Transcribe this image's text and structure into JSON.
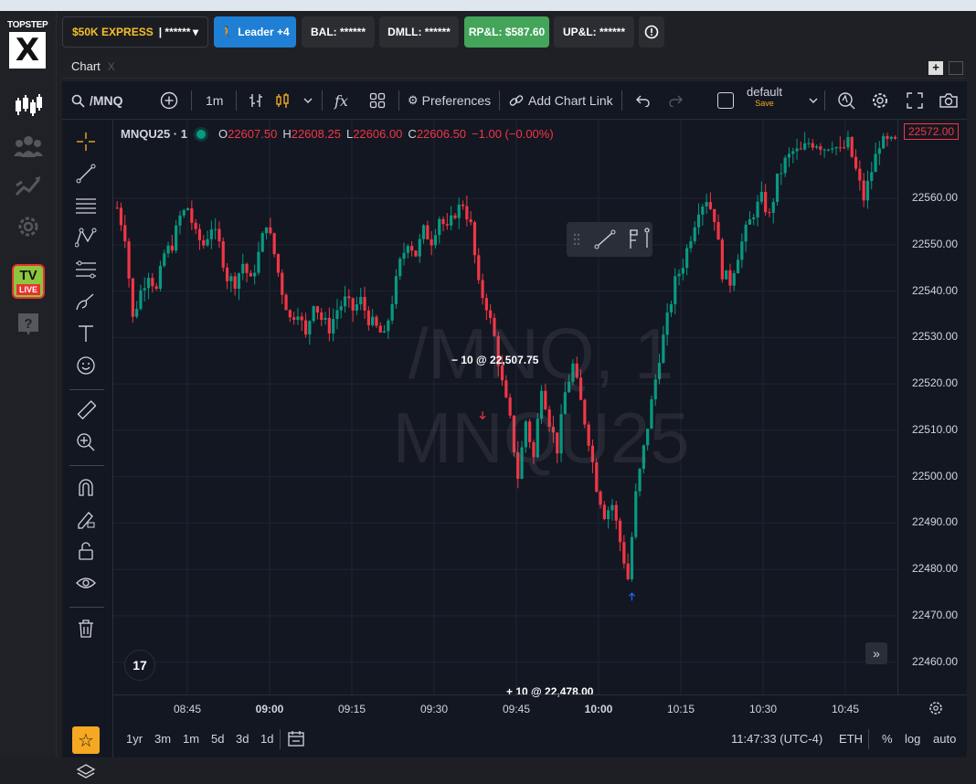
{
  "brand": {
    "top": "TOPSTEP",
    "mark": "X"
  },
  "tv_badge": {
    "top": "TV",
    "bottom": "LIVE"
  },
  "account_bar": {
    "account_name": "$50K EXPRESS",
    "account_masked": "| ******",
    "leader_label": "Leader +4",
    "bal": "BAL: ******",
    "dmll": "DMLL: ******",
    "rpl": "RP&L: $587.60",
    "upl": "UP&L: ******"
  },
  "tabs": {
    "chart": "Chart",
    "close": "X"
  },
  "toolbar": {
    "symbol": "/MNQ",
    "interval": "1m",
    "indicators": "fx",
    "preferences": "Preferences",
    "add_chart_link": "Add Chart Link",
    "layout_name": "default",
    "layout_save": "Save"
  },
  "legend": {
    "symbol": "MNQU25 · 1",
    "o_label": "O",
    "o": "22607.50",
    "h_label": "H",
    "h": "22608.25",
    "l_label": "L",
    "l": "22606.00",
    "c_label": "C",
    "c": "22606.50",
    "change": "−1.00 (−0.00%)"
  },
  "watermark": {
    "line1": "/MNQ, 1",
    "line2": "MNQU25"
  },
  "last_price_tag": "22572.00",
  "trades": {
    "sell": "− 10 @ 22,507.75",
    "buy": "+ 10 @ 22,478.00"
  },
  "bottom": {
    "ranges": [
      "1yr",
      "3m",
      "1m",
      "5d",
      "3d",
      "1d"
    ],
    "clock": "11:47:33 (UTC-4)",
    "session": "ETH",
    "pct": "%",
    "log": "log",
    "auto": "auto"
  },
  "colors": {
    "up": "#089981",
    "down": "#f23645",
    "bg": "#131722",
    "accent": "#f6a822"
  },
  "chart_data": {
    "type": "candlestick",
    "ylim": [
      22455,
      22575
    ],
    "y_ticks": [
      "22560.00",
      "22550.00",
      "22540.00",
      "22530.00",
      "22520.00",
      "22510.00",
      "22500.00",
      "22490.00",
      "22480.00",
      "22470.00",
      "22460.00"
    ],
    "x_ticks": [
      "08:45",
      "09:00",
      "09:15",
      "09:30",
      "09:45",
      "10:00",
      "10:15",
      "10:30",
      "10:45"
    ],
    "x_ticks_bold": [
      "09:00",
      "10:00"
    ],
    "close_path": [
      [
        0,
        22558
      ],
      [
        2,
        22552
      ],
      [
        4,
        22534
      ],
      [
        6,
        22540
      ],
      [
        8,
        22544
      ],
      [
        10,
        22540
      ],
      [
        12,
        22548
      ],
      [
        14,
        22550
      ],
      [
        16,
        22556
      ],
      [
        18,
        22558
      ],
      [
        20,
        22552
      ],
      [
        22,
        22550
      ],
      [
        24,
        22554
      ],
      [
        26,
        22550
      ],
      [
        28,
        22543
      ],
      [
        30,
        22542
      ],
      [
        32,
        22546
      ],
      [
        34,
        22542
      ],
      [
        36,
        22548
      ],
      [
        38,
        22555
      ],
      [
        40,
        22548
      ],
      [
        42,
        22540
      ],
      [
        44,
        22534
      ],
      [
        46,
        22536
      ],
      [
        48,
        22530
      ],
      [
        50,
        22538
      ],
      [
        52,
        22534
      ],
      [
        54,
        22532
      ],
      [
        56,
        22536
      ],
      [
        58,
        22538
      ],
      [
        60,
        22536
      ],
      [
        62,
        22538
      ],
      [
        64,
        22534
      ],
      [
        66,
        22532
      ],
      [
        68,
        22530
      ],
      [
        70,
        22538
      ],
      [
        72,
        22546
      ],
      [
        74,
        22551
      ],
      [
        76,
        22548
      ],
      [
        78,
        22553
      ],
      [
        80,
        22551
      ],
      [
        82,
        22556
      ],
      [
        84,
        22553
      ],
      [
        86,
        22557
      ],
      [
        88,
        22559
      ],
      [
        90,
        22554
      ],
      [
        92,
        22541
      ],
      [
        94,
        22537
      ],
      [
        96,
        22530
      ],
      [
        98,
        22520
      ],
      [
        100,
        22512
      ],
      [
        102,
        22500
      ],
      [
        104,
        22512
      ],
      [
        106,
        22504
      ],
      [
        108,
        22520
      ],
      [
        110,
        22512
      ],
      [
        112,
        22506
      ],
      [
        114,
        22518
      ],
      [
        116,
        22524
      ],
      [
        118,
        22516
      ],
      [
        120,
        22508
      ],
      [
        122,
        22498
      ],
      [
        124,
        22492
      ],
      [
        126,
        22494
      ],
      [
        128,
        22486
      ],
      [
        130,
        22478
      ],
      [
        132,
        22496
      ],
      [
        134,
        22506
      ],
      [
        136,
        22516
      ],
      [
        138,
        22526
      ],
      [
        140,
        22534
      ],
      [
        142,
        22542
      ],
      [
        144,
        22546
      ],
      [
        146,
        22552
      ],
      [
        148,
        22558
      ],
      [
        150,
        22560
      ],
      [
        152,
        22556
      ],
      [
        154,
        22544
      ],
      [
        156,
        22542
      ],
      [
        158,
        22548
      ],
      [
        160,
        22553
      ],
      [
        162,
        22557
      ],
      [
        164,
        22560
      ],
      [
        166,
        22556
      ],
      [
        168,
        22564
      ],
      [
        170,
        22568
      ],
      [
        172,
        22570
      ],
      [
        174,
        22570
      ],
      [
        176,
        22572
      ],
      [
        178,
        22572
      ],
      [
        180,
        22571
      ],
      [
        182,
        22572
      ],
      [
        184,
        22570
      ],
      [
        186,
        22572
      ],
      [
        188,
        22566
      ],
      [
        190,
        22560
      ],
      [
        192,
        22566
      ],
      [
        194,
        22572
      ],
      [
        196,
        22572
      ],
      [
        198,
        22572
      ],
      [
        200,
        22572
      ]
    ],
    "bars_count": 200,
    "trade_markers": [
      {
        "side": "sell",
        "price": 22507.75,
        "bar": 93
      },
      {
        "side": "buy",
        "price": 22478.0,
        "bar": 131
      }
    ]
  }
}
